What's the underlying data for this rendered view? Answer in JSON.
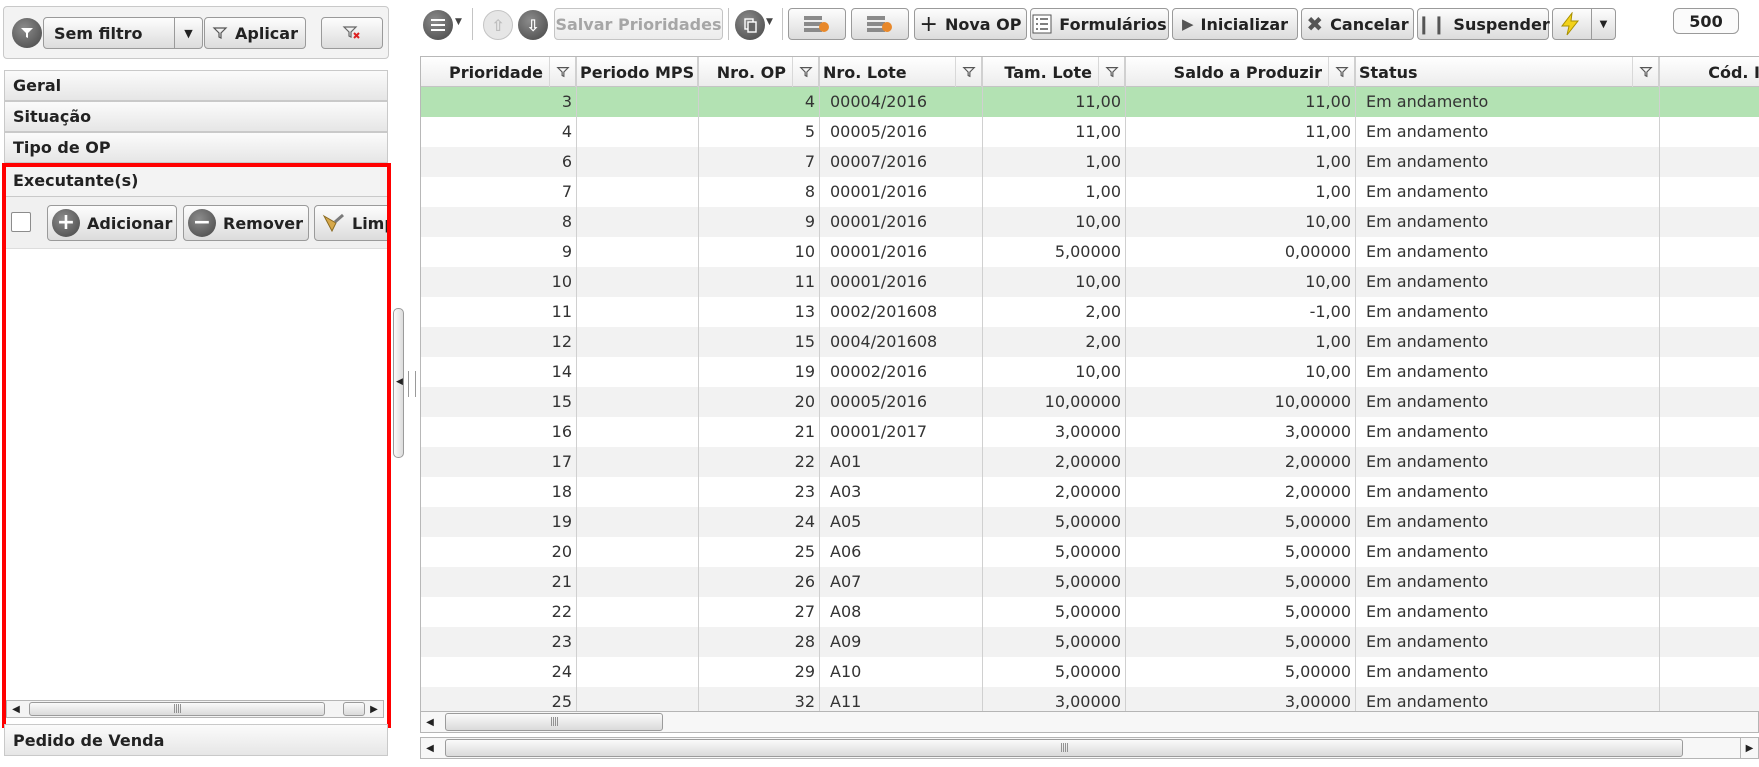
{
  "filter": {
    "selected": "Sem filtro",
    "apply_label": "Aplicar"
  },
  "sections": {
    "geral": "Geral",
    "situacao": "Situação",
    "tipo_op": "Tipo de OP",
    "executantes": "Executante(s)",
    "pedido_venda": "Pedido de Venda"
  },
  "executantes_toolbar": {
    "add_label": "Adicionar",
    "remove_label": "Remover",
    "clear_label": "Limp"
  },
  "toolbar": {
    "save_priorities": "Salvar Prioridades",
    "new_op": "Nova OP",
    "forms": "Formulários",
    "start": "Inicializar",
    "cancel": "Cancelar",
    "suspend": "Suspender",
    "page_size": "500"
  },
  "grid": {
    "columns": [
      "Prioridade",
      "Periodo MPS",
      "Nro. OP",
      "Nro. Lote",
      "Tam. Lote",
      "Saldo a Produzir",
      "Status",
      "Cód. I"
    ],
    "rows": [
      {
        "prioridade": "3",
        "periodo_mps": "",
        "nro_op": "4",
        "nro_lote": "00004/2016",
        "tam_lote": "11,00",
        "saldo": "11,00",
        "status": "Em andamento"
      },
      {
        "prioridade": "4",
        "periodo_mps": "",
        "nro_op": "5",
        "nro_lote": "00005/2016",
        "tam_lote": "11,00",
        "saldo": "11,00",
        "status": "Em andamento"
      },
      {
        "prioridade": "6",
        "periodo_mps": "",
        "nro_op": "7",
        "nro_lote": "00007/2016",
        "tam_lote": "1,00",
        "saldo": "1,00",
        "status": "Em andamento"
      },
      {
        "prioridade": "7",
        "periodo_mps": "",
        "nro_op": "8",
        "nro_lote": "00001/2016",
        "tam_lote": "1,00",
        "saldo": "1,00",
        "status": "Em andamento"
      },
      {
        "prioridade": "8",
        "periodo_mps": "",
        "nro_op": "9",
        "nro_lote": "00001/2016",
        "tam_lote": "10,00",
        "saldo": "10,00",
        "status": "Em andamento"
      },
      {
        "prioridade": "9",
        "periodo_mps": "",
        "nro_op": "10",
        "nro_lote": "00001/2016",
        "tam_lote": "5,00000",
        "saldo": "0,00000",
        "status": "Em andamento"
      },
      {
        "prioridade": "10",
        "periodo_mps": "",
        "nro_op": "11",
        "nro_lote": "00001/2016",
        "tam_lote": "10,00",
        "saldo": "10,00",
        "status": "Em andamento"
      },
      {
        "prioridade": "11",
        "periodo_mps": "",
        "nro_op": "13",
        "nro_lote": "0002/201608",
        "tam_lote": "2,00",
        "saldo": "-1,00",
        "status": "Em andamento"
      },
      {
        "prioridade": "12",
        "periodo_mps": "",
        "nro_op": "15",
        "nro_lote": "0004/201608",
        "tam_lote": "2,00",
        "saldo": "1,00",
        "status": "Em andamento"
      },
      {
        "prioridade": "14",
        "periodo_mps": "",
        "nro_op": "19",
        "nro_lote": "00002/2016",
        "tam_lote": "10,00",
        "saldo": "10,00",
        "status": "Em andamento"
      },
      {
        "prioridade": "15",
        "periodo_mps": "",
        "nro_op": "20",
        "nro_lote": "00005/2016",
        "tam_lote": "10,00000",
        "saldo": "10,00000",
        "status": "Em andamento"
      },
      {
        "prioridade": "16",
        "periodo_mps": "",
        "nro_op": "21",
        "nro_lote": "00001/2017",
        "tam_lote": "3,00000",
        "saldo": "3,00000",
        "status": "Em andamento"
      },
      {
        "prioridade": "17",
        "periodo_mps": "",
        "nro_op": "22",
        "nro_lote": "A01",
        "tam_lote": "2,00000",
        "saldo": "2,00000",
        "status": "Em andamento"
      },
      {
        "prioridade": "18",
        "periodo_mps": "",
        "nro_op": "23",
        "nro_lote": "A03",
        "tam_lote": "2,00000",
        "saldo": "2,00000",
        "status": "Em andamento"
      },
      {
        "prioridade": "19",
        "periodo_mps": "",
        "nro_op": "24",
        "nro_lote": "A05",
        "tam_lote": "5,00000",
        "saldo": "5,00000",
        "status": "Em andamento"
      },
      {
        "prioridade": "20",
        "periodo_mps": "",
        "nro_op": "25",
        "nro_lote": "A06",
        "tam_lote": "5,00000",
        "saldo": "5,00000",
        "status": "Em andamento"
      },
      {
        "prioridade": "21",
        "periodo_mps": "",
        "nro_op": "26",
        "nro_lote": "A07",
        "tam_lote": "5,00000",
        "saldo": "5,00000",
        "status": "Em andamento"
      },
      {
        "prioridade": "22",
        "periodo_mps": "",
        "nro_op": "27",
        "nro_lote": "A08",
        "tam_lote": "5,00000",
        "saldo": "5,00000",
        "status": "Em andamento"
      },
      {
        "prioridade": "23",
        "periodo_mps": "",
        "nro_op": "28",
        "nro_lote": "A09",
        "tam_lote": "5,00000",
        "saldo": "5,00000",
        "status": "Em andamento"
      },
      {
        "prioridade": "24",
        "periodo_mps": "",
        "nro_op": "29",
        "nro_lote": "A10",
        "tam_lote": "5,00000",
        "saldo": "5,00000",
        "status": "Em andamento"
      },
      {
        "prioridade": "25",
        "periodo_mps": "",
        "nro_op": "32",
        "nro_lote": "A11",
        "tam_lote": "3,00000",
        "saldo": "3,00000",
        "status": "Em andamento"
      }
    ]
  },
  "colors": {
    "selected_row": "#b3e2b3",
    "highlight_frame": "#ff0000",
    "lightning": "#f2d21a"
  },
  "icons": {
    "filter_menu": "funnel-menu-icon",
    "clear_filter": "funnel-clear-icon",
    "move_up": "arrow-up-icon",
    "move_down": "arrow-down-icon",
    "lightning": "lightning-icon"
  }
}
